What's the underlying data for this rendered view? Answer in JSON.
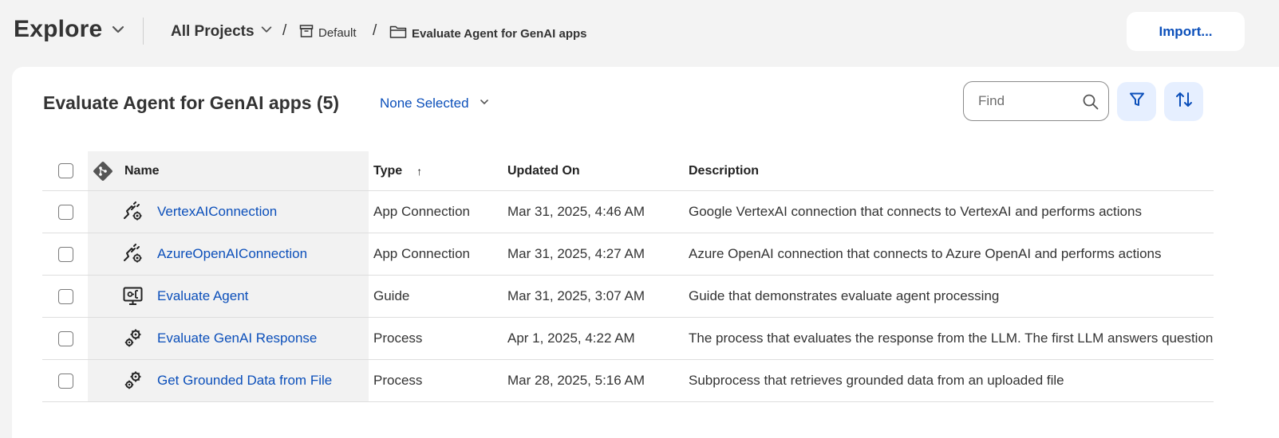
{
  "topbar": {
    "explore_label": "Explore",
    "breadcrumb": {
      "all_projects": "All Projects",
      "separator": "/",
      "default": "Default",
      "current": "Evaluate Agent for GenAI apps"
    },
    "import_label": "Import..."
  },
  "panel": {
    "title": "Evaluate Agent for GenAI apps (5)",
    "selection_label": "None Selected",
    "find_placeholder": "Find"
  },
  "table": {
    "headers": {
      "name": "Name",
      "type": "Type",
      "type_sort": "↑",
      "updated": "Updated On",
      "description": "Description"
    },
    "rows": [
      {
        "icon": "app-connection-icon",
        "name": "VertexAIConnection",
        "type": "App Connection",
        "updated": "Mar 31, 2025, 4:46 AM",
        "description": "Google VertexAI connection that connects to VertexAI and performs actions"
      },
      {
        "icon": "app-connection-icon",
        "name": "AzureOpenAIConnection",
        "type": "App Connection",
        "updated": "Mar 31, 2025, 4:27 AM",
        "description": "Azure OpenAI connection that connects to Azure OpenAI and performs actions"
      },
      {
        "icon": "guide-icon",
        "name": "Evaluate Agent",
        "type": "Guide",
        "updated": "Mar 31, 2025, 3:07 AM",
        "description": "Guide that demonstrates evaluate agent processing"
      },
      {
        "icon": "process-icon",
        "name": "Evaluate GenAI Response",
        "type": "Process",
        "updated": "Apr 1, 2025, 4:22 AM",
        "description": "The process that evaluates the response from the LLM. The first LLM answers questions"
      },
      {
        "icon": "process-icon",
        "name": "Get Grounded Data from File",
        "type": "Process",
        "updated": "Mar 28, 2025, 5:16 AM",
        "description": "Subprocess that retrieves grounded data from an uploaded file"
      }
    ]
  },
  "colors": {
    "accent": "#0b4fba",
    "icon_button_bg": "#e6efff",
    "page_bg": "#f3f3f3"
  }
}
